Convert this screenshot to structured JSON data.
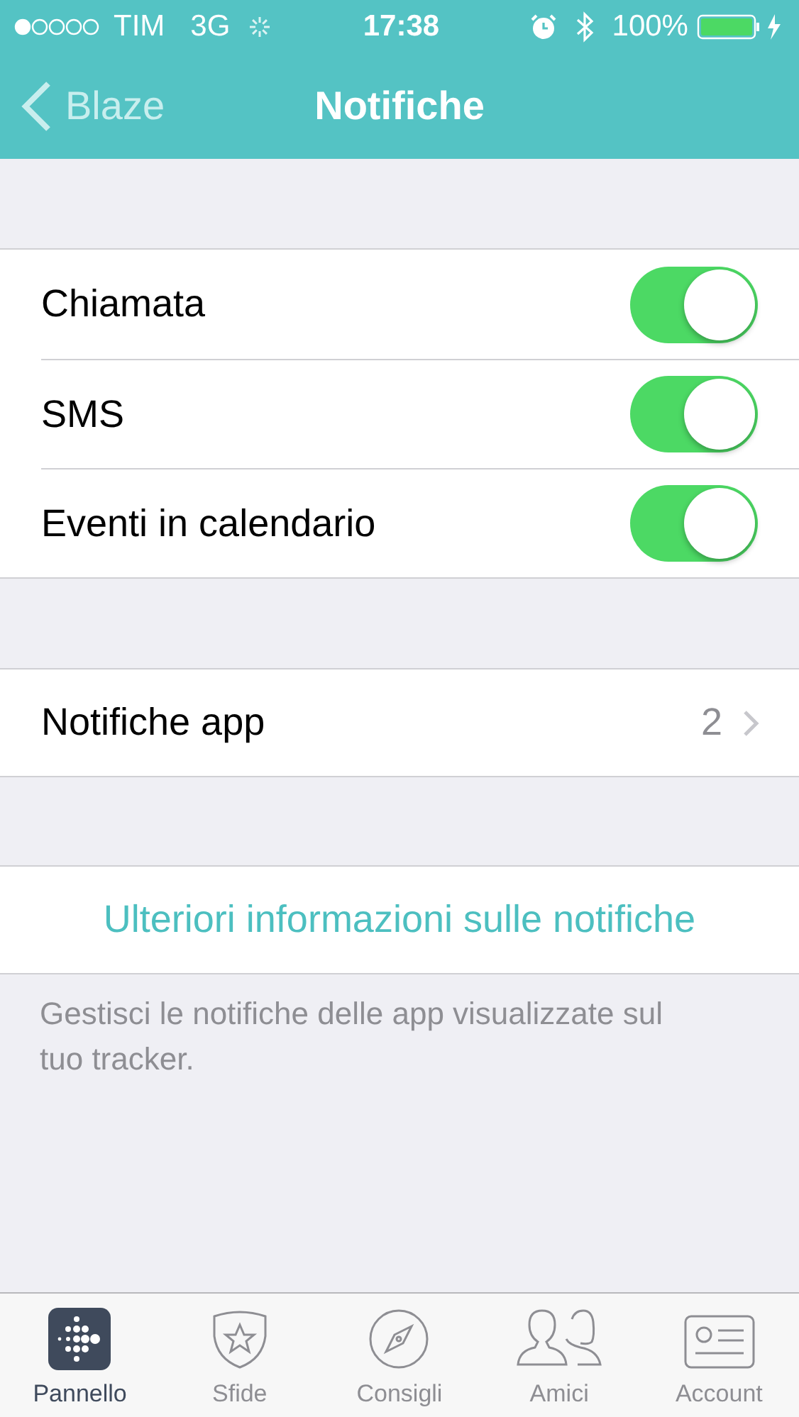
{
  "status_bar": {
    "carrier": "TIM",
    "network": "3G",
    "time": "17:38",
    "battery": "100%"
  },
  "nav": {
    "back": "Blaze",
    "title": "Notifiche"
  },
  "switches": [
    {
      "label": "Chiamata",
      "on": true
    },
    {
      "label": "SMS",
      "on": true
    },
    {
      "label": "Eventi in calendario",
      "on": true
    }
  ],
  "app_notifications": {
    "label": "Notifiche app",
    "count": "2"
  },
  "link": "Ulteriori informazioni sulle notifiche",
  "footer": "Gestisci le notifiche delle app visualizzate sul tuo tracker.",
  "tabs": [
    {
      "label": "Pannello",
      "kind": "dashboard",
      "selected": true
    },
    {
      "label": "Sfide",
      "kind": "challenges",
      "selected": false
    },
    {
      "label": "Consigli",
      "kind": "guidance",
      "selected": false
    },
    {
      "label": "Amici",
      "kind": "friends",
      "selected": false
    },
    {
      "label": "Account",
      "kind": "account",
      "selected": false
    }
  ]
}
